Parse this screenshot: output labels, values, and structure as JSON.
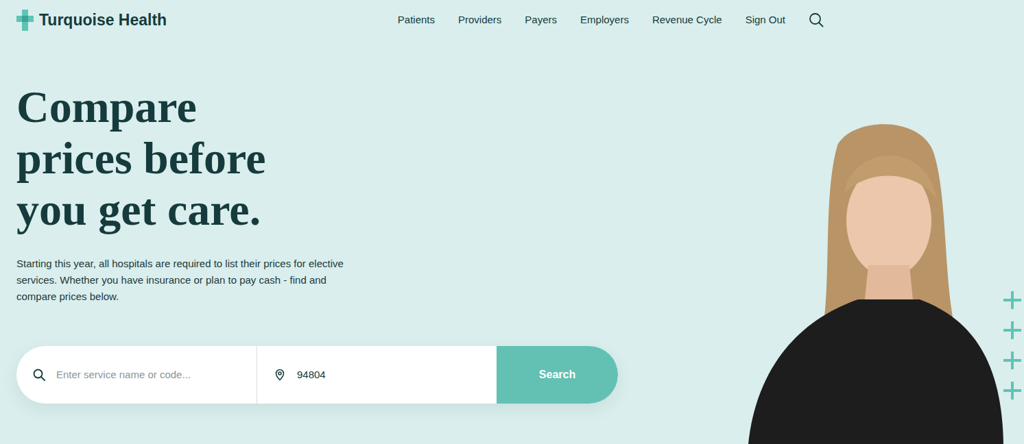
{
  "logo": {
    "text": "Turquoise Health"
  },
  "nav": {
    "items": [
      {
        "label": "Patients"
      },
      {
        "label": "Providers"
      },
      {
        "label": "Payers"
      },
      {
        "label": "Employers"
      },
      {
        "label": "Revenue Cycle"
      },
      {
        "label": "Sign Out"
      }
    ]
  },
  "hero": {
    "title_lines": [
      "Compare",
      "prices before",
      "you get care."
    ],
    "description": "Starting this year, all hospitals are required to list their prices for elective services. Whether you have insurance or plan to pay cash - find and compare prices below."
  },
  "search": {
    "placeholder": "Enter service name or code...",
    "location": "94804",
    "button": "Search"
  }
}
